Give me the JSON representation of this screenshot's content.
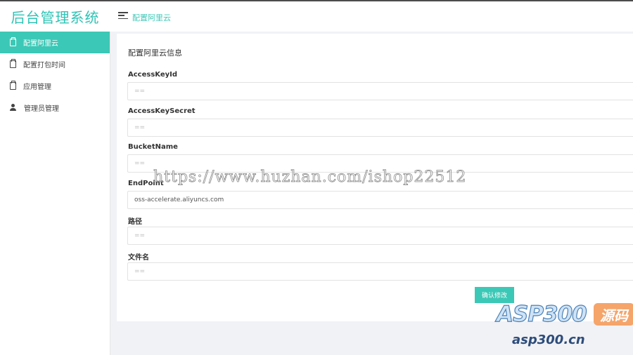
{
  "header": {
    "brand": "后台管理系统",
    "breadcrumb": "配置阿里云"
  },
  "sidebar": {
    "items": [
      {
        "label": "配置阿里云",
        "icon": "clipboard-icon",
        "active": true
      },
      {
        "label": "配置打包时间",
        "icon": "clipboard-icon",
        "active": false
      },
      {
        "label": "应用管理",
        "icon": "clipboard-icon",
        "active": false
      },
      {
        "label": "管理员管理",
        "icon": "user-icon",
        "active": false
      }
    ]
  },
  "form": {
    "title": "配置阿里云信息",
    "fields": [
      {
        "label": "AccessKeyId",
        "value": "",
        "placeholder": "=="
      },
      {
        "label": "AccessKeySecret",
        "value": "",
        "placeholder": "=="
      },
      {
        "label": "BucketName",
        "value": "",
        "placeholder": "=="
      },
      {
        "label": "EndPoint",
        "value": "oss-accelerate.aliyuncs.com",
        "placeholder": ""
      },
      {
        "label": "路径",
        "value": "",
        "placeholder": "=="
      },
      {
        "label": "文件名",
        "value": "",
        "placeholder": "=="
      }
    ],
    "submit_label": "确认修改"
  },
  "watermark": {
    "url": "https://www.huzhan.com/ishop22512",
    "logo_text": "ASP300",
    "logo_badge": "源码",
    "domain": "asp300.cn"
  },
  "colors": {
    "accent": "#3cc8b6",
    "brand": "#2ec4b6"
  }
}
